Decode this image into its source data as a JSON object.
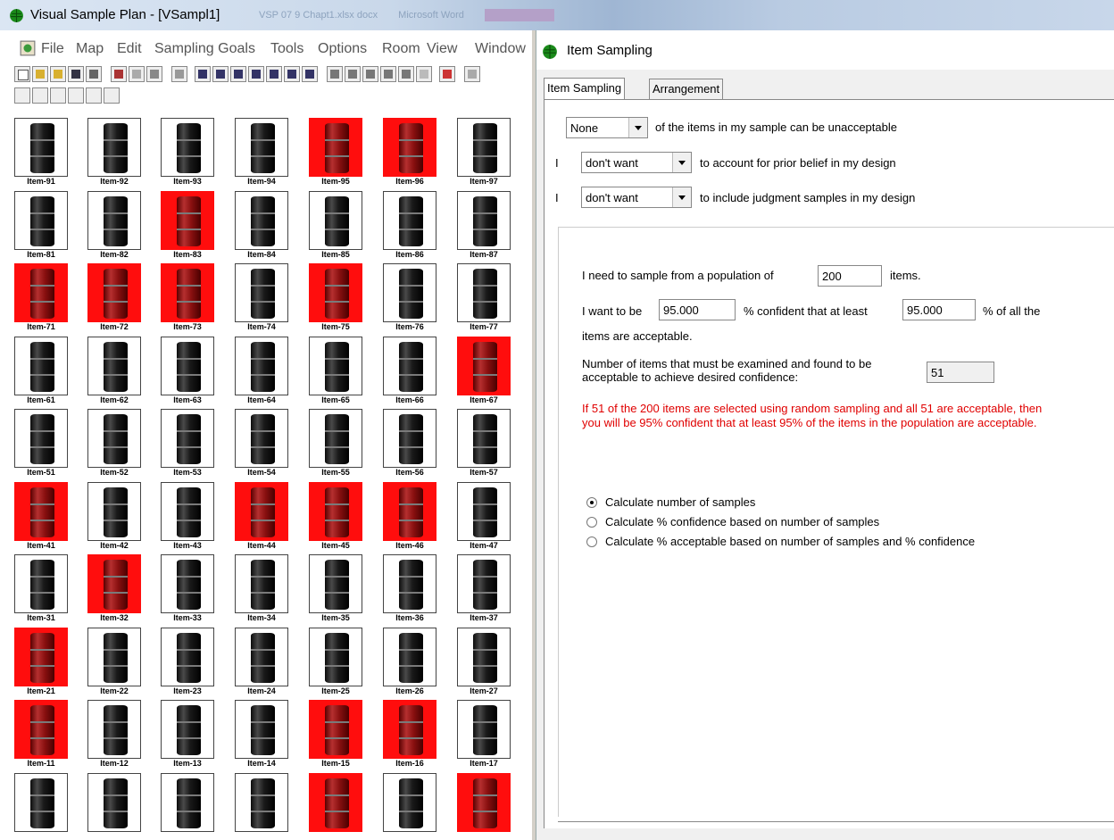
{
  "main_window": {
    "title": "Visual Sample Plan - [VSampl1]",
    "ghost_taskbar": [
      "VSP 07 9 Chapt1.xlsx docx",
      "Microsoft Word"
    ],
    "menu": [
      "File",
      "Map",
      "Edit",
      "Sampling Goals",
      "Tools",
      "Options",
      "Room",
      "View",
      "Window"
    ]
  },
  "grid": {
    "rows": [
      {
        "items": [
          {
            "label": "Item-91",
            "red": false
          },
          {
            "label": "Item-92",
            "red": false
          },
          {
            "label": "Item-93",
            "red": false
          },
          {
            "label": "Item-94",
            "red": false
          },
          {
            "label": "Item-95",
            "red": true
          },
          {
            "label": "Item-96",
            "red": true
          },
          {
            "label": "Item-97",
            "red": false
          }
        ]
      },
      {
        "items": [
          {
            "label": "Item-81",
            "red": false
          },
          {
            "label": "Item-82",
            "red": false
          },
          {
            "label": "Item-83",
            "red": true
          },
          {
            "label": "Item-84",
            "red": false
          },
          {
            "label": "Item-85",
            "red": false
          },
          {
            "label": "Item-86",
            "red": false
          },
          {
            "label": "Item-87",
            "red": false
          }
        ]
      },
      {
        "items": [
          {
            "label": "Item-71",
            "red": true
          },
          {
            "label": "Item-72",
            "red": true
          },
          {
            "label": "Item-73",
            "red": true
          },
          {
            "label": "Item-74",
            "red": false
          },
          {
            "label": "Item-75",
            "red": true
          },
          {
            "label": "Item-76",
            "red": false
          },
          {
            "label": "Item-77",
            "red": false
          }
        ]
      },
      {
        "items": [
          {
            "label": "Item-61",
            "red": false
          },
          {
            "label": "Item-62",
            "red": false
          },
          {
            "label": "Item-63",
            "red": false
          },
          {
            "label": "Item-64",
            "red": false
          },
          {
            "label": "Item-65",
            "red": false
          },
          {
            "label": "Item-66",
            "red": false
          },
          {
            "label": "Item-67",
            "red": true
          }
        ]
      },
      {
        "items": [
          {
            "label": "Item-51",
            "red": false
          },
          {
            "label": "Item-52",
            "red": false
          },
          {
            "label": "Item-53",
            "red": false
          },
          {
            "label": "Item-54",
            "red": false
          },
          {
            "label": "Item-55",
            "red": false
          },
          {
            "label": "Item-56",
            "red": false
          },
          {
            "label": "Item-57",
            "red": false
          }
        ]
      },
      {
        "items": [
          {
            "label": "Item-41",
            "red": true
          },
          {
            "label": "Item-42",
            "red": false
          },
          {
            "label": "Item-43",
            "red": false
          },
          {
            "label": "Item-44",
            "red": true
          },
          {
            "label": "Item-45",
            "red": true
          },
          {
            "label": "Item-46",
            "red": true
          },
          {
            "label": "Item-47",
            "red": false
          }
        ]
      },
      {
        "items": [
          {
            "label": "Item-31",
            "red": false
          },
          {
            "label": "Item-32",
            "red": true
          },
          {
            "label": "Item-33",
            "red": false
          },
          {
            "label": "Item-34",
            "red": false
          },
          {
            "label": "Item-35",
            "red": false
          },
          {
            "label": "Item-36",
            "red": false
          },
          {
            "label": "Item-37",
            "red": false
          }
        ]
      },
      {
        "items": [
          {
            "label": "Item-21",
            "red": true
          },
          {
            "label": "Item-22",
            "red": false
          },
          {
            "label": "Item-23",
            "red": false
          },
          {
            "label": "Item-24",
            "red": false
          },
          {
            "label": "Item-25",
            "red": false
          },
          {
            "label": "Item-26",
            "red": false
          },
          {
            "label": "Item-27",
            "red": false
          }
        ]
      },
      {
        "items": [
          {
            "label": "Item-11",
            "red": true
          },
          {
            "label": "Item-12",
            "red": false
          },
          {
            "label": "Item-13",
            "red": false
          },
          {
            "label": "Item-14",
            "red": false
          },
          {
            "label": "Item-15",
            "red": true
          },
          {
            "label": "Item-16",
            "red": true
          },
          {
            "label": "Item-17",
            "red": false
          }
        ]
      },
      {
        "items": [
          {
            "label": "",
            "red": false
          },
          {
            "label": "",
            "red": false
          },
          {
            "label": "",
            "red": false
          },
          {
            "label": "",
            "red": false
          },
          {
            "label": "",
            "red": true
          },
          {
            "label": "",
            "red": false
          },
          {
            "label": "",
            "red": true
          }
        ]
      }
    ]
  },
  "dialog": {
    "title": "Item Sampling",
    "tabs": [
      "Item Sampling",
      "Arrangement"
    ],
    "unacceptable": {
      "value": "None",
      "text": "of the items in my sample can be unacceptable"
    },
    "prior_belief": {
      "prefix": "I",
      "value": "don't want",
      "text": "to account for prior belief in my design"
    },
    "judgment": {
      "prefix": "I",
      "value": "don't want",
      "text": "to include judgment samples in my design"
    },
    "population": {
      "prefix": "I need to sample from a population of",
      "value": "200",
      "suffix": "items."
    },
    "confidence": {
      "prefix": "I want to be",
      "confidence_value": "95.000",
      "middle": "% confident that at least",
      "acceptable_value": "95.000",
      "suffix": "% of all the",
      "line2": "items are acceptable."
    },
    "examined": {
      "line1": "Number of items that must be examined and found to be",
      "line2": "acceptable to achieve desired confidence:",
      "value": "51"
    },
    "result": {
      "line1": "If 51 of the 200 items are selected using random sampling and all 51 are acceptable, then",
      "line2": "you will be 95% confident that at least 95% of the items in the population are acceptable."
    },
    "options": [
      {
        "label": "Calculate number of samples",
        "checked": true
      },
      {
        "label": "Calculate % confidence based on number of samples",
        "checked": false
      },
      {
        "label": "Calculate % acceptable based on number of samples and % confidence",
        "checked": false
      }
    ],
    "colors": {
      "result_text": "#e00000",
      "bad_item": "#ff0d0d"
    }
  }
}
